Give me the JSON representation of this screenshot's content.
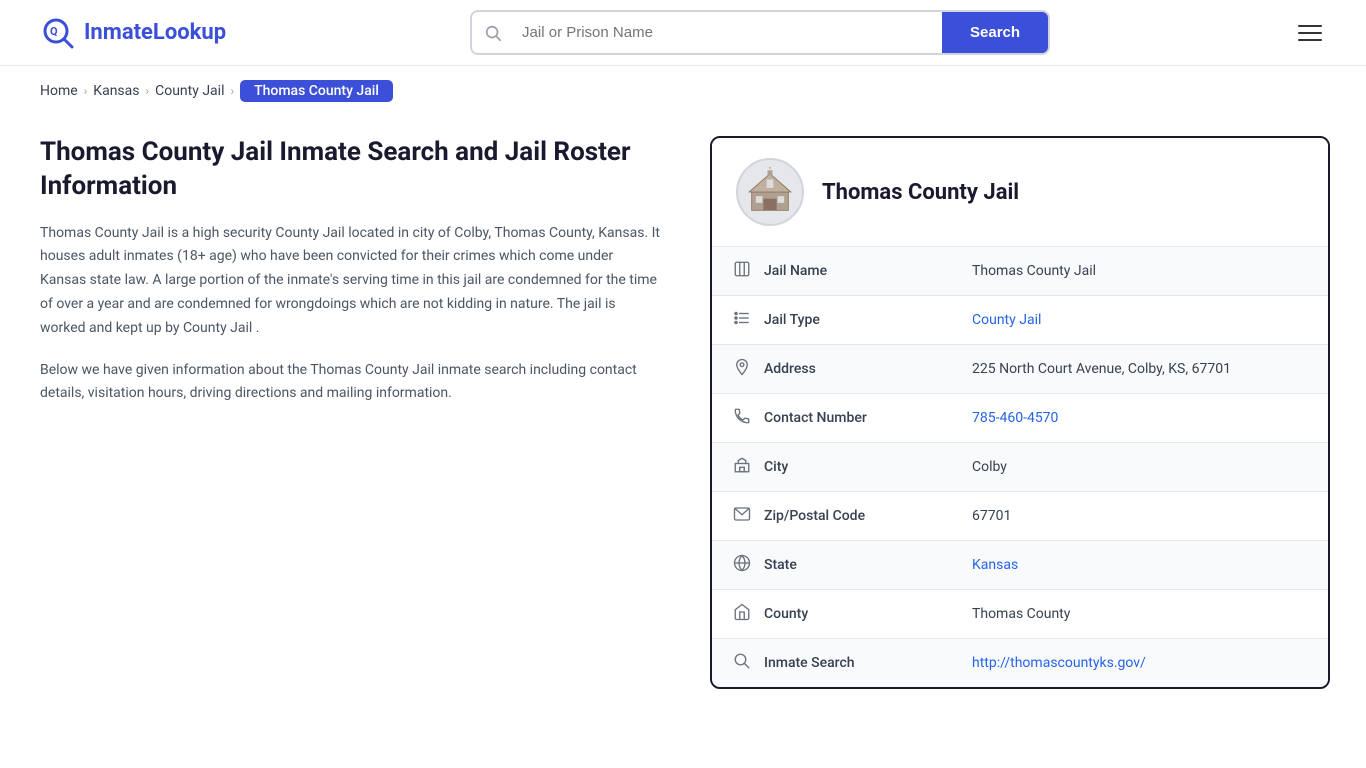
{
  "header": {
    "logo_text_part1": "Inmate",
    "logo_text_part2": "Lookup",
    "search_placeholder": "Jail or Prison Name",
    "search_button_label": "Search"
  },
  "breadcrumb": {
    "home": "Home",
    "kansas": "Kansas",
    "county_jail": "County Jail",
    "current": "Thomas County Jail"
  },
  "left": {
    "page_title": "Thomas County Jail Inmate Search and Jail Roster Information",
    "desc1": "Thomas County Jail is a high security County Jail located in city of Colby, Thomas County, Kansas. It houses adult inmates (18+ age) who have been convicted for their crimes which come under Kansas state law. A large portion of the inmate's serving time in this jail are condemned for the time of over a year and are condemned for wrongdoings which are not kidding in nature. The jail is worked and kept up by County Jail .",
    "desc2": "Below we have given information about the Thomas County Jail inmate search including contact details, visitation hours, driving directions and mailing information."
  },
  "card": {
    "facility_name": "Thomas County Jail",
    "rows": [
      {
        "icon": "jail",
        "label": "Jail Name",
        "value": "Thomas County Jail",
        "link": false
      },
      {
        "icon": "list",
        "label": "Jail Type",
        "value": "County Jail",
        "link": true,
        "link_href": "#"
      },
      {
        "icon": "location",
        "label": "Address",
        "value": "225 North Court Avenue, Colby, KS, 67701",
        "link": false
      },
      {
        "icon": "phone",
        "label": "Contact Number",
        "value": "785-460-4570",
        "link": true,
        "link_href": "tel:785-460-4570"
      },
      {
        "icon": "city",
        "label": "City",
        "value": "Colby",
        "link": false
      },
      {
        "icon": "mail",
        "label": "Zip/Postal Code",
        "value": "67701",
        "link": false
      },
      {
        "icon": "globe",
        "label": "State",
        "value": "Kansas",
        "link": true,
        "link_href": "#"
      },
      {
        "icon": "county",
        "label": "County",
        "value": "Thomas County",
        "link": false
      },
      {
        "icon": "search",
        "label": "Inmate Search",
        "value": "http://thomascountyks.gov/",
        "link": true,
        "link_href": "http://thomascountyks.gov/"
      }
    ]
  }
}
